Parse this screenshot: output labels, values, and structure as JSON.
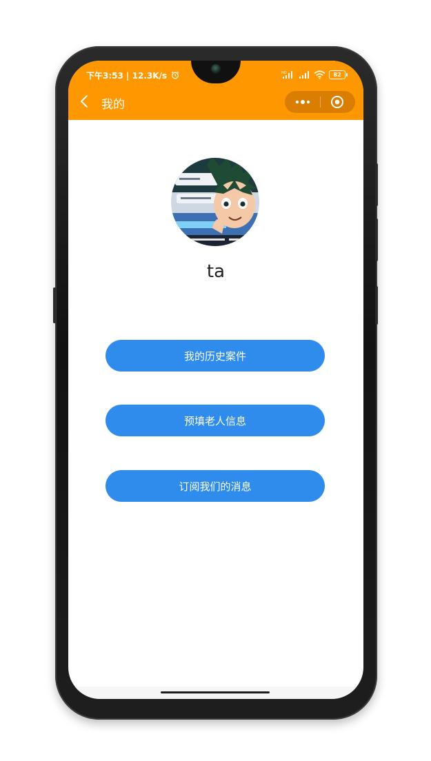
{
  "status_bar": {
    "time": "下午3:53",
    "speed": "12.3K/s",
    "network_label": "HD",
    "battery": "82"
  },
  "nav": {
    "title": "我的"
  },
  "profile": {
    "username": "ta"
  },
  "menu": [
    {
      "label": "我的历史案件"
    },
    {
      "label": "预填老人信息"
    },
    {
      "label": "订阅我们的消息"
    }
  ],
  "colors": {
    "header": "#ff9800",
    "button": "#2f8cec"
  }
}
